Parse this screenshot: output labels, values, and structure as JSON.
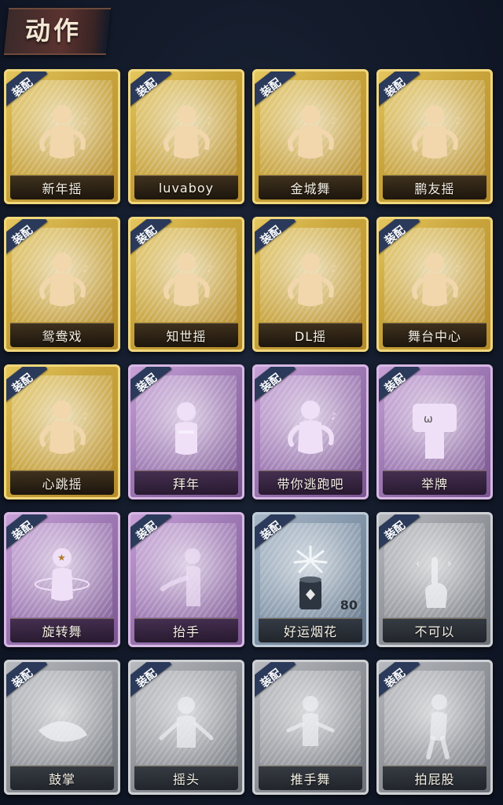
{
  "header": {
    "title": "动作"
  },
  "equip_tag": "装配",
  "cards": [
    {
      "label": "新年摇",
      "tier": "gold",
      "icon": "dancer-figure-icon"
    },
    {
      "label": "luvaboy",
      "tier": "gold",
      "icon": "dancer-figure-icon"
    },
    {
      "label": "金城舞",
      "tier": "gold",
      "icon": "dancer-figure-icon"
    },
    {
      "label": "鹏友摇",
      "tier": "gold",
      "icon": "dancer-figure-icon"
    },
    {
      "label": "鸳鸯戏",
      "tier": "gold",
      "icon": "dancer-figure-icon"
    },
    {
      "label": "知世摇",
      "tier": "gold",
      "icon": "dancer-figure-icon"
    },
    {
      "label": "DL摇",
      "tier": "gold",
      "icon": "dancer-figure-icon"
    },
    {
      "label": "舞台中心",
      "tier": "gold",
      "icon": "dancer-figure-icon"
    },
    {
      "label": "心跳摇",
      "tier": "gold",
      "icon": "dancer-figure-icon"
    },
    {
      "label": "拜年",
      "tier": "purple",
      "icon": "bowing-figure-icon"
    },
    {
      "label": "带你逃跑吧",
      "tier": "purple",
      "icon": "dancer-figure-icon"
    },
    {
      "label": "举牌",
      "tier": "purple",
      "icon": "sign-holding-figure-icon"
    },
    {
      "label": "旋转舞",
      "tier": "purple",
      "icon": "spinning-figure-icon"
    },
    {
      "label": "抬手",
      "tier": "purple",
      "icon": "raise-hand-figure-icon"
    },
    {
      "label": "好运烟花",
      "tier": "blue",
      "icon": "firework-icon",
      "count": "80"
    },
    {
      "label": "不可以",
      "tier": "gray",
      "icon": "finger-wag-icon"
    },
    {
      "label": "鼓掌",
      "tier": "gray",
      "icon": "clapping-hands-icon"
    },
    {
      "label": "摇头",
      "tier": "gray",
      "icon": "shaking-head-figure-icon"
    },
    {
      "label": "推手舞",
      "tier": "gray",
      "icon": "push-hands-figure-icon"
    },
    {
      "label": "拍屁股",
      "tier": "gray",
      "icon": "butt-pat-figure-icon"
    }
  ]
}
